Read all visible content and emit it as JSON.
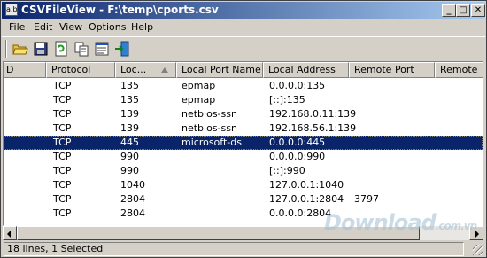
{
  "window": {
    "title": "CSVFileView  -  F:\\temp\\cports.csv",
    "app_icon": "a,b",
    "controls": {
      "minimize": "_",
      "maximize": "□",
      "close": "✕"
    }
  },
  "menu": [
    "File",
    "Edit",
    "View",
    "Options",
    "Help"
  ],
  "toolbar": [
    "open-folder-icon",
    "save-icon",
    "refresh-icon",
    "copy-icon",
    "properties-icon",
    "exit-icon"
  ],
  "table": {
    "columns": [
      {
        "label": "D"
      },
      {
        "label": "Protocol"
      },
      {
        "label": "Loc..."
      },
      {
        "label": "Local Port Name"
      },
      {
        "label": "Local Address"
      },
      {
        "label": "Remote Port"
      },
      {
        "label": "Remote"
      }
    ],
    "sort_column": "Loc...",
    "rows": [
      [
        "TCP",
        "135",
        "epmap",
        "0.0.0.0:135",
        ""
      ],
      [
        "TCP",
        "135",
        "epmap",
        "[::]:135",
        ""
      ],
      [
        "TCP",
        "139",
        "netbios-ssn",
        "192.168.0.11:139",
        ""
      ],
      [
        "TCP",
        "139",
        "netbios-ssn",
        "192.168.56.1:139",
        ""
      ],
      [
        "TCP",
        "445",
        "microsoft-ds",
        "0.0.0.0:445",
        ""
      ],
      [
        "TCP",
        "990",
        "",
        "0.0.0.0:990",
        ""
      ],
      [
        "TCP",
        "990",
        "",
        "[::]:990",
        ""
      ],
      [
        "TCP",
        "1040",
        "",
        "127.0.0.1:1040",
        ""
      ],
      [
        "TCP",
        "2804",
        "",
        "127.0.0.1:2804",
        "3797"
      ],
      [
        "TCP",
        "2804",
        "",
        "0.0.0.0:2804",
        ""
      ]
    ],
    "selected_row": 4
  },
  "status": {
    "text": "18 lines, 1 Selected"
  },
  "watermark": {
    "text": "Download",
    "suffix": ".com.vn"
  }
}
